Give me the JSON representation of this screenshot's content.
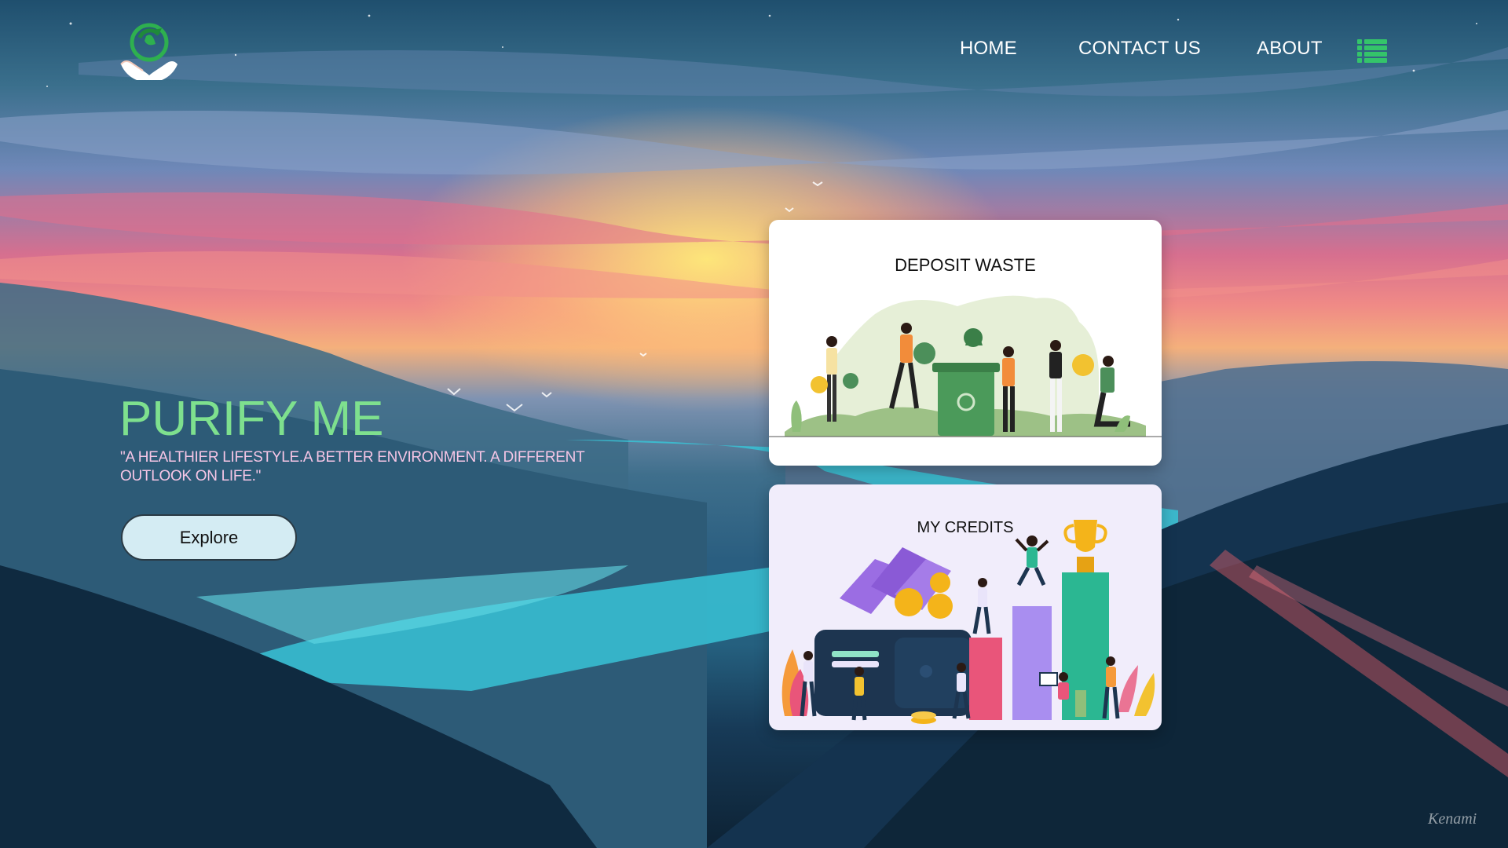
{
  "nav": {
    "home": "HOME",
    "contact": "CONTACT US",
    "about": "ABOUT"
  },
  "hero": {
    "title": "PURIFY ME",
    "tagline": "\"A HEALTHIER LIFESTYLE.A BETTER ENVIRONMENT. A DIFFERENT OUTLOOK ON LIFE.\"",
    "cta": "Explore"
  },
  "cards": [
    {
      "title": "DEPOSIT WASTE"
    },
    {
      "title": "MY CREDITS"
    }
  ],
  "artist_signature": "Kenami",
  "icons": {
    "logo": "recycle-hands-logo-icon",
    "menu": "list-menu-icon"
  },
  "colors": {
    "title_green": "#7ee08e",
    "tagline_pink": "#f6c6e6",
    "button_bg": "#d4ecf3",
    "menu_green": "#34c46a"
  }
}
